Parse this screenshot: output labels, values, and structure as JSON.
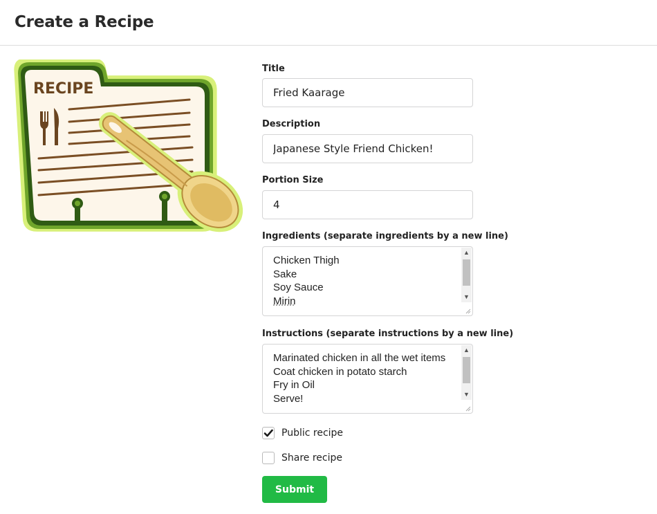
{
  "header": {
    "title": "Create a Recipe"
  },
  "illustration": {
    "badge_text": "RECIPE"
  },
  "form": {
    "title": {
      "label": "Title",
      "value": "Fried Kaarage"
    },
    "description": {
      "label": "Description",
      "value": "Japanese Style Friend Chicken!"
    },
    "portion": {
      "label": "Portion Size",
      "value": "4"
    },
    "ingredients": {
      "label": "Ingredients (separate ingredients by a new line)",
      "lines": [
        "Chicken Thigh",
        "Sake",
        "Soy Sauce",
        "Mirin"
      ]
    },
    "instructions": {
      "label": "Instructions (separate instructions by a new line)",
      "lines": [
        "Marinated chicken in all the wet items",
        "Coat chicken in potato starch",
        "Fry in Oil",
        "Serve!"
      ]
    },
    "public_recipe": {
      "label": "Public recipe",
      "checked": true
    },
    "share_recipe": {
      "label": "Share recipe",
      "checked": false
    },
    "submit_label": "Submit"
  },
  "colors": {
    "submit": "#21ba45",
    "border": "#d4d4d5",
    "recipe_green": "#8cc63f"
  }
}
